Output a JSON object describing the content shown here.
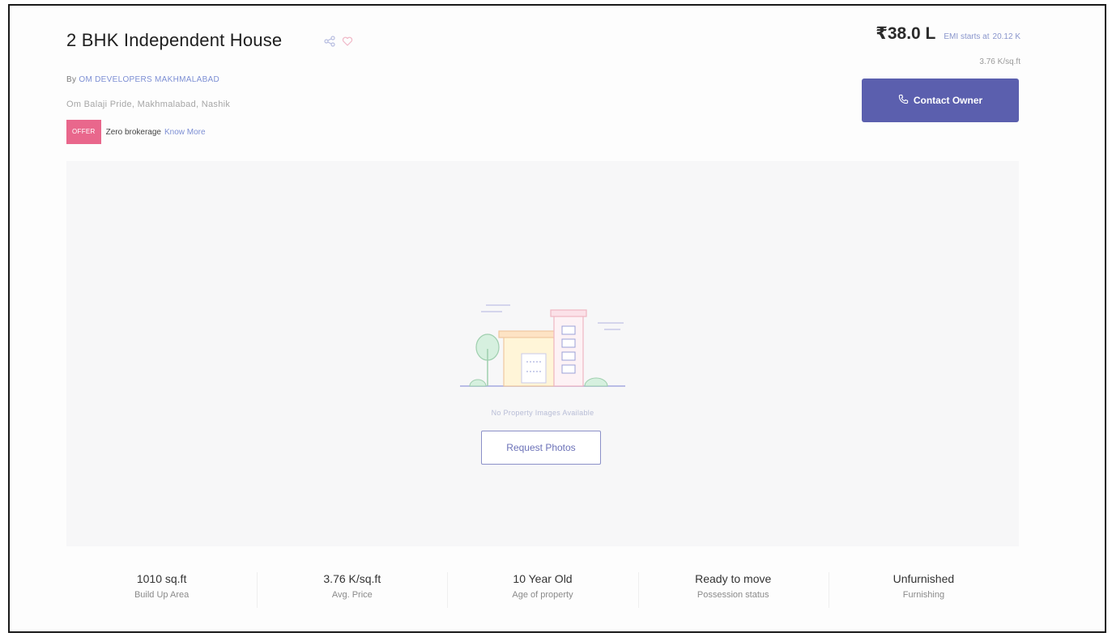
{
  "listing": {
    "title": "2 BHK Independent House",
    "by_prefix": "By",
    "developer": "OM DEVELOPERS MAKHMALABAD",
    "location": "Om Balaji Pride, Makhmalabad, Nashik",
    "offer_badge": "OFFER",
    "offer_text": "Zero brokerage",
    "offer_link": "Know More"
  },
  "price": {
    "amount": "₹38.0 L",
    "emi_label": "EMI starts at",
    "emi_value": "20.12 K",
    "per_sqft": "3.76 K/sq.ft"
  },
  "actions": {
    "contact_owner": "Contact Owner",
    "request_photos": "Request Photos"
  },
  "gallery": {
    "empty_message": "No Property Images Available"
  },
  "stats": [
    {
      "value": "1010 sq.ft",
      "label": "Build Up Area"
    },
    {
      "value": "3.76 K/sq.ft",
      "label": "Avg. Price"
    },
    {
      "value": "10 Year Old",
      "label": "Age of property"
    },
    {
      "value": "Ready to move",
      "label": "Possession status"
    },
    {
      "value": "Unfurnished",
      "label": "Furnishing"
    }
  ],
  "icons": {
    "share": "share-icon",
    "favorite": "heart-icon",
    "phone": "phone-icon",
    "placeholder": "building-illustration"
  },
  "colors": {
    "accent": "#5b5fae",
    "link": "#7d8fd4",
    "offer": "#e9678c"
  }
}
